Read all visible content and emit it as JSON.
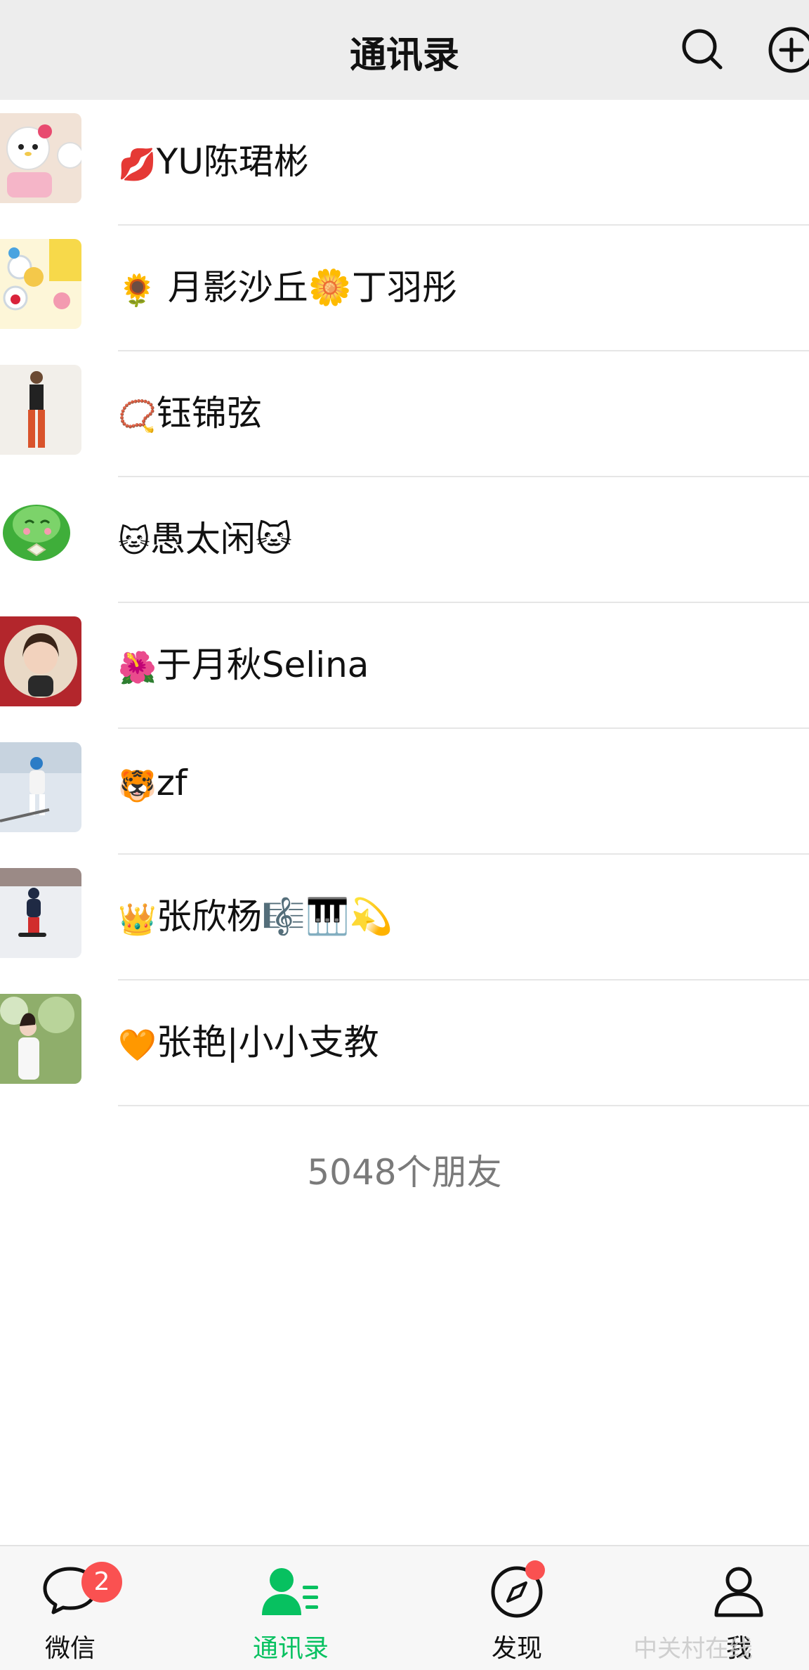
{
  "header": {
    "title": "通讯录"
  },
  "contacts": [
    {
      "emoji": "💋",
      "name": "YU陈珺彬"
    },
    {
      "emoji": "🌻",
      "name": " 月影沙丘🌼丁羽彤"
    },
    {
      "emoji": "📿",
      "name": "钰锦弦"
    },
    {
      "emoji": "🐱",
      "name": "愚太闲🐱"
    },
    {
      "emoji": "🌺",
      "name": "于月秋Selina"
    },
    {
      "emoji": "🐯",
      "name": "zf"
    },
    {
      "emoji": "👑",
      "name": "张欣杨🎼🎹💫"
    },
    {
      "emoji": "🧡",
      "name": "张艳|小小支教"
    }
  ],
  "friend_count": "5048个朋友",
  "tabbar": {
    "chats": {
      "label": "微信",
      "badge": "2"
    },
    "contacts": {
      "label": "通讯录"
    },
    "discover": {
      "label": "发现"
    },
    "me": {
      "label": "我"
    }
  },
  "watermark": "中关村在线",
  "colors": {
    "accent": "#07c160",
    "badge": "#fa5151",
    "header_bg": "#ededed"
  }
}
